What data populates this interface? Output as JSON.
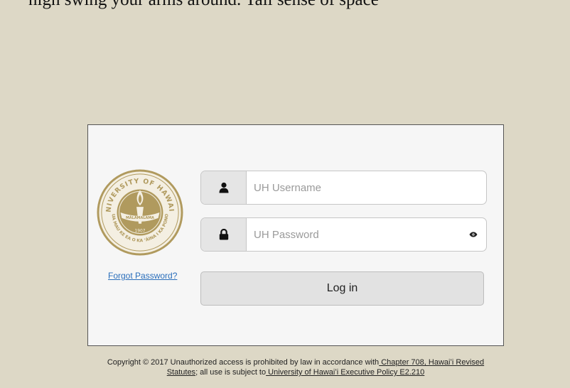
{
  "top_text": "nigh swing your arms around. Tall sense of space",
  "seal": {
    "name": "university-of-hawaii-seal",
    "top_text": "UNIVERSITY OF HAWAIʻI",
    "bottom_text": "UA MAU KE EA O KA ʻĀINA I KA PONO",
    "banner_text": "MĀLAMALAMA",
    "year": "1907",
    "color": "#b09a5e"
  },
  "login": {
    "username_placeholder": "UH Username",
    "password_placeholder": "UH Password",
    "username_icon": "user-icon",
    "password_icon": "lock-icon",
    "visibility_icon": "eye-icon",
    "forgot_password": "Forgot Password?",
    "submit_label": "Log in"
  },
  "footer": {
    "text_1": "Copyright © 2017 Unauthorized access is prohibited by law in accordance with",
    "link_1": " Chapter 708, Hawaiʻi Revised Statutes",
    "text_2": "; all use is subject to",
    "link_2": " University of Hawaiʻi Executive Policy E2.210"
  },
  "colors": {
    "page_background": "#ddd8c6",
    "panel_background": "#f6f6f6",
    "link": "#2a6ebb",
    "seal_gold": "#b09a5e"
  }
}
